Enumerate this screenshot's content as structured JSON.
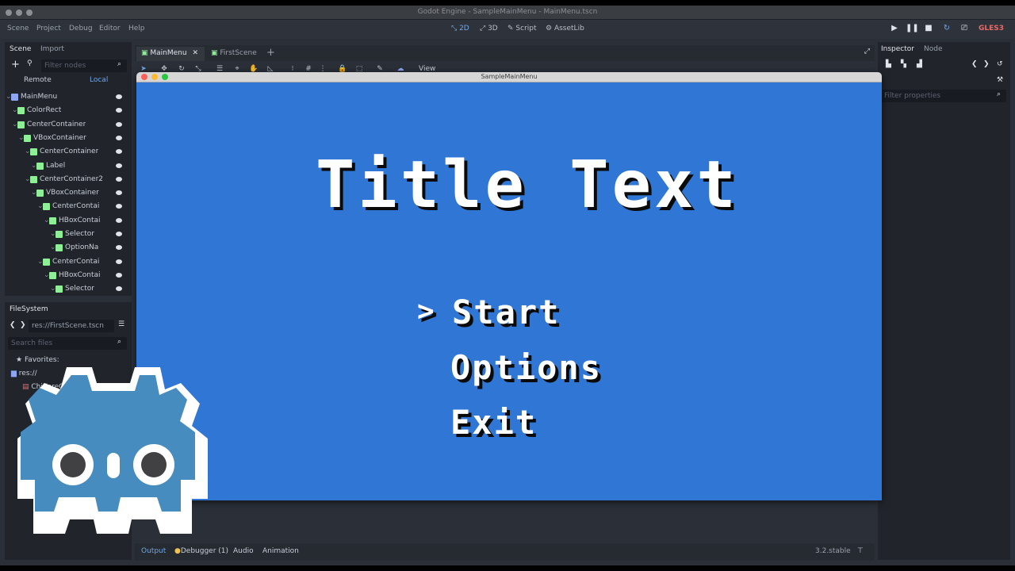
{
  "window_title": "Godot Engine - SampleMainMenu - MainMenu.tscn",
  "menus": [
    "Scene",
    "Project",
    "Debug",
    "Editor",
    "Help"
  ],
  "workspaces": {
    "w2d": "2D",
    "w3d": "3D",
    "script": "Script",
    "assetlib": "AssetLib"
  },
  "renderer": "GLES3",
  "scene_dock": {
    "tabs": [
      "Scene",
      "Import"
    ],
    "filter_placeholder": "Filter nodes",
    "remote": "Remote",
    "local": "Local",
    "nodes": [
      {
        "label": "MainMenu",
        "depth": 0,
        "color": "#8da5f3"
      },
      {
        "label": "ColorRect",
        "depth": 1,
        "color": "#8eef97"
      },
      {
        "label": "CenterContainer",
        "depth": 1,
        "color": "#8eef97"
      },
      {
        "label": "VBoxContainer",
        "depth": 2,
        "color": "#8eef97"
      },
      {
        "label": "CenterContainer",
        "depth": 3,
        "color": "#8eef97"
      },
      {
        "label": "Label",
        "depth": 4,
        "color": "#8eef97"
      },
      {
        "label": "CenterContainer2",
        "depth": 3,
        "color": "#8eef97"
      },
      {
        "label": "VBoxContainer",
        "depth": 4,
        "color": "#8eef97"
      },
      {
        "label": "CenterContai",
        "depth": 5,
        "color": "#8eef97"
      },
      {
        "label": "HBoxContai",
        "depth": 6,
        "color": "#8eef97"
      },
      {
        "label": "Selector",
        "depth": 7,
        "color": "#8eef97"
      },
      {
        "label": "OptionNa",
        "depth": 7,
        "color": "#8eef97"
      },
      {
        "label": "CenterContai",
        "depth": 5,
        "color": "#8eef97"
      },
      {
        "label": "HBoxContai",
        "depth": 6,
        "color": "#8eef97"
      },
      {
        "label": "Selector",
        "depth": 7,
        "color": "#8eef97"
      }
    ]
  },
  "filesystem": {
    "tab": "FileSystem",
    "path": "res://FirstScene.tscn",
    "search_placeholder": "Search files",
    "favorites": "Favorites:",
    "root": "res://",
    "item": "ChiKareG"
  },
  "editor_tabs": [
    "MainMenu",
    "FirstScene"
  ],
  "toolbar_view": "View",
  "game_window": {
    "title": "SampleMainMenu",
    "heading": "Title Text",
    "selector": ">",
    "options": [
      "Start",
      "Options",
      "Exit"
    ]
  },
  "inspector": {
    "tabs": [
      "Inspector",
      "Node"
    ],
    "filter_placeholder": "Filter properties"
  },
  "bottom_panel": {
    "tabs": [
      "Output",
      "Debugger (1)",
      "Audio",
      "Animation"
    ],
    "version": "3.2.stable"
  }
}
